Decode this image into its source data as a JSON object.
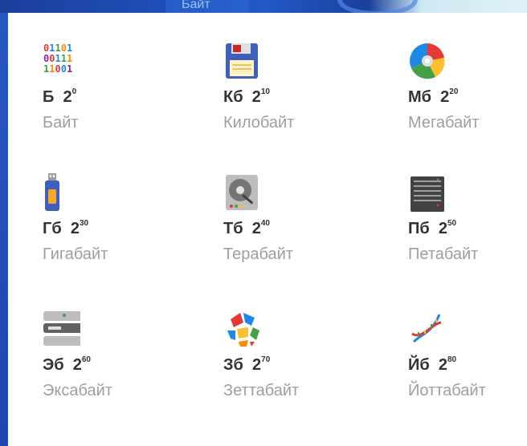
{
  "header": {
    "partial_label": "Байт"
  },
  "units": [
    {
      "abbr": "Б",
      "exp": "0",
      "name": "Байт",
      "icon": "binary-digits-icon"
    },
    {
      "abbr": "Кб",
      "exp": "10",
      "name": "Килобайт",
      "icon": "floppy-disk-icon"
    },
    {
      "abbr": "Мб",
      "exp": "20",
      "name": "Мегабайт",
      "icon": "compact-disc-icon"
    },
    {
      "abbr": "Гб",
      "exp": "30",
      "name": "Гигабайт",
      "icon": "usb-flash-drive-icon"
    },
    {
      "abbr": "Тб",
      "exp": "40",
      "name": "Терабайт",
      "icon": "hard-disk-drive-icon"
    },
    {
      "abbr": "Пб",
      "exp": "50",
      "name": "Петабайт",
      "icon": "server-rack-icon"
    },
    {
      "abbr": "Эб",
      "exp": "60",
      "name": "Эксабайт",
      "icon": "server-stack-icon"
    },
    {
      "abbr": "Зб",
      "exp": "70",
      "name": "Зеттабайт",
      "icon": "colorful-sphere-icon"
    },
    {
      "abbr": "Йб",
      "exp": "80",
      "name": "Йоттабайт",
      "icon": "dna-helix-icon"
    }
  ],
  "colors": {
    "background": "#1f4fb8",
    "card": "#ffffff",
    "abbr_text": "#333333",
    "name_text": "#9e9e9e"
  }
}
